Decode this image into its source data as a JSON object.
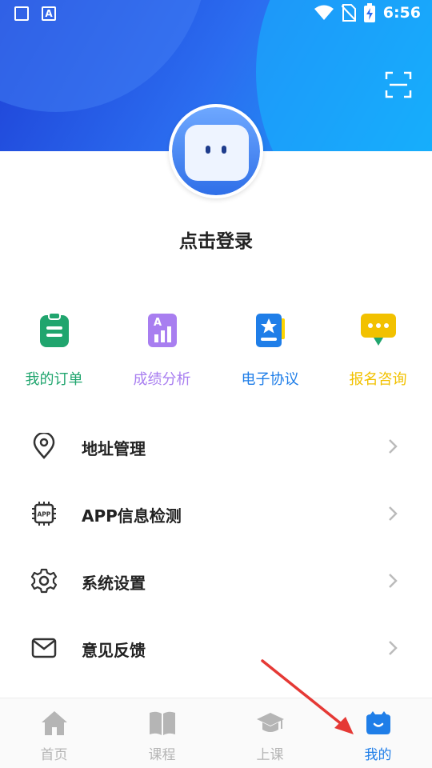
{
  "status_bar": {
    "time": "6:56",
    "left_icons": [
      "image-icon",
      "font-icon"
    ],
    "right_icons": [
      "wifi-icon",
      "no-sim-icon",
      "battery-charging-icon"
    ]
  },
  "header": {
    "scan_icon": "scan-icon"
  },
  "profile": {
    "login_text": "点击登录"
  },
  "quick_actions": [
    {
      "label": "我的订单",
      "color": "#20a56e",
      "icon": "clipboard-icon"
    },
    {
      "label": "成绩分析",
      "color": "#a87ef0",
      "icon": "chart-icon"
    },
    {
      "label": "电子协议",
      "color": "#1f7ee8",
      "icon": "agreement-icon"
    },
    {
      "label": "报名咨询",
      "color": "#f2c100",
      "icon": "chat-icon"
    }
  ],
  "menu": [
    {
      "label": "地址管理",
      "icon": "location-icon"
    },
    {
      "label": "APP信息检测",
      "icon": "chip-icon"
    },
    {
      "label": "系统设置",
      "icon": "gear-icon"
    },
    {
      "label": "意见反馈",
      "icon": "mail-icon"
    }
  ],
  "tabs": [
    {
      "label": "首页",
      "icon": "home-icon",
      "active": false
    },
    {
      "label": "课程",
      "icon": "book-icon",
      "active": false
    },
    {
      "label": "上课",
      "icon": "graduation-cap-icon",
      "active": false
    },
    {
      "label": "我的",
      "icon": "profile-icon",
      "active": true
    }
  ],
  "colors": {
    "accent": "#1f7ee8",
    "tab_inactive": "#b5b5b5",
    "annotation_arrow": "#e53935"
  }
}
